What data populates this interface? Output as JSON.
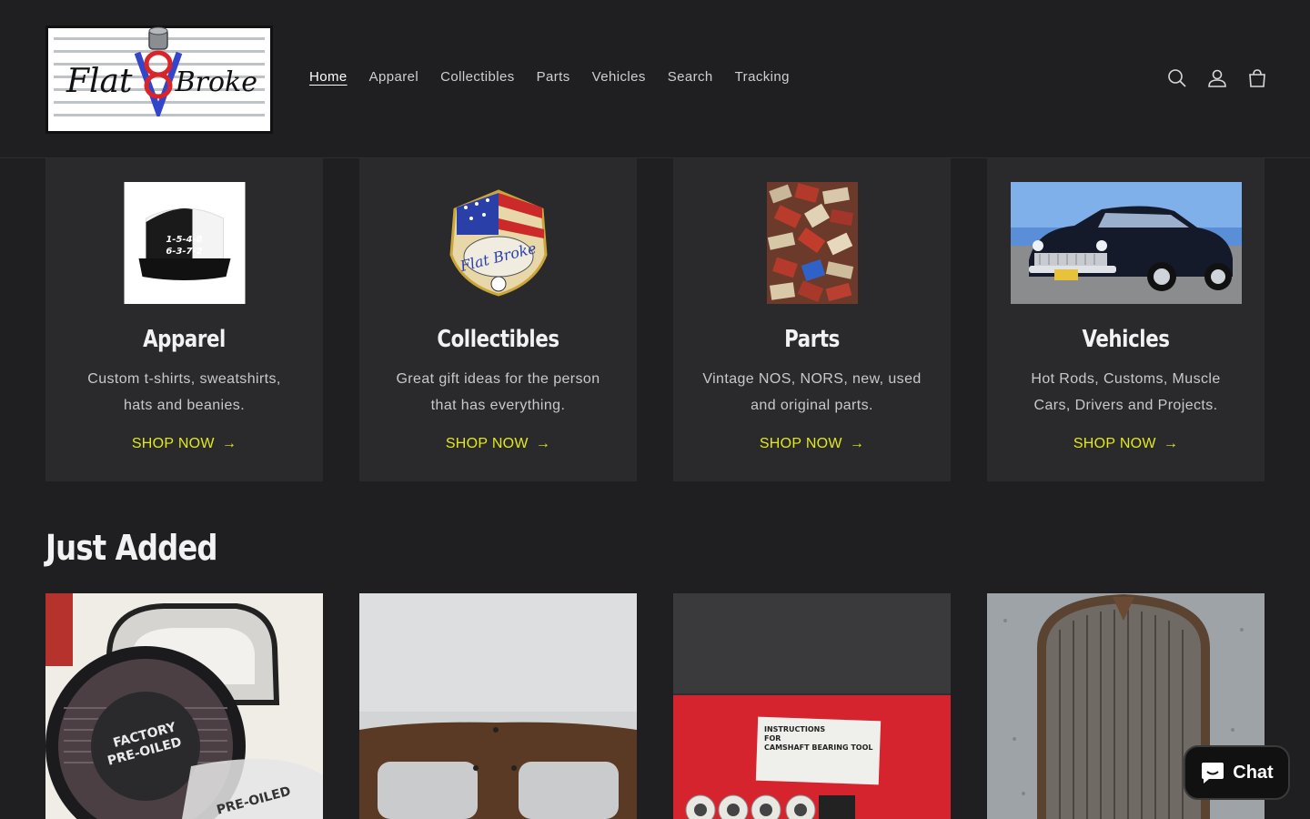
{
  "header": {
    "logo_text_left": "Flat",
    "logo_text_right": "Broke",
    "nav": [
      {
        "label": "Home",
        "active": true
      },
      {
        "label": "Apparel",
        "active": false
      },
      {
        "label": "Collectibles",
        "active": false
      },
      {
        "label": "Parts",
        "active": false
      },
      {
        "label": "Vehicles",
        "active": false
      },
      {
        "label": "Search",
        "active": false
      },
      {
        "label": "Tracking",
        "active": false
      }
    ],
    "icons": [
      "search-icon",
      "account-icon",
      "cart-icon"
    ]
  },
  "collections": [
    {
      "title": "Apparel",
      "description": "Custom t-shirts, sweatshirts, hats and beanies.",
      "cta": "SHOP NOW",
      "hat_text": "1-5-4-8\n6-3-7-2"
    },
    {
      "title": "Collectibles",
      "description": "Great gift ideas for the person that has everything.",
      "cta": "SHOP NOW"
    },
    {
      "title": "Parts",
      "description": "Vintage NOS, NORS, new, used and original parts.",
      "cta": "SHOP NOW"
    },
    {
      "title": "Vehicles",
      "description": "Hot Rods, Customs, Muscle Cars, Drivers and Projects.",
      "cta": "SHOP NOW"
    }
  ],
  "just_added": {
    "title": "Just Added"
  },
  "chat": {
    "label": "Chat"
  },
  "colors": {
    "background": "#1f1f21",
    "card": "#2a2a2d",
    "accent": "#e2e81a"
  }
}
